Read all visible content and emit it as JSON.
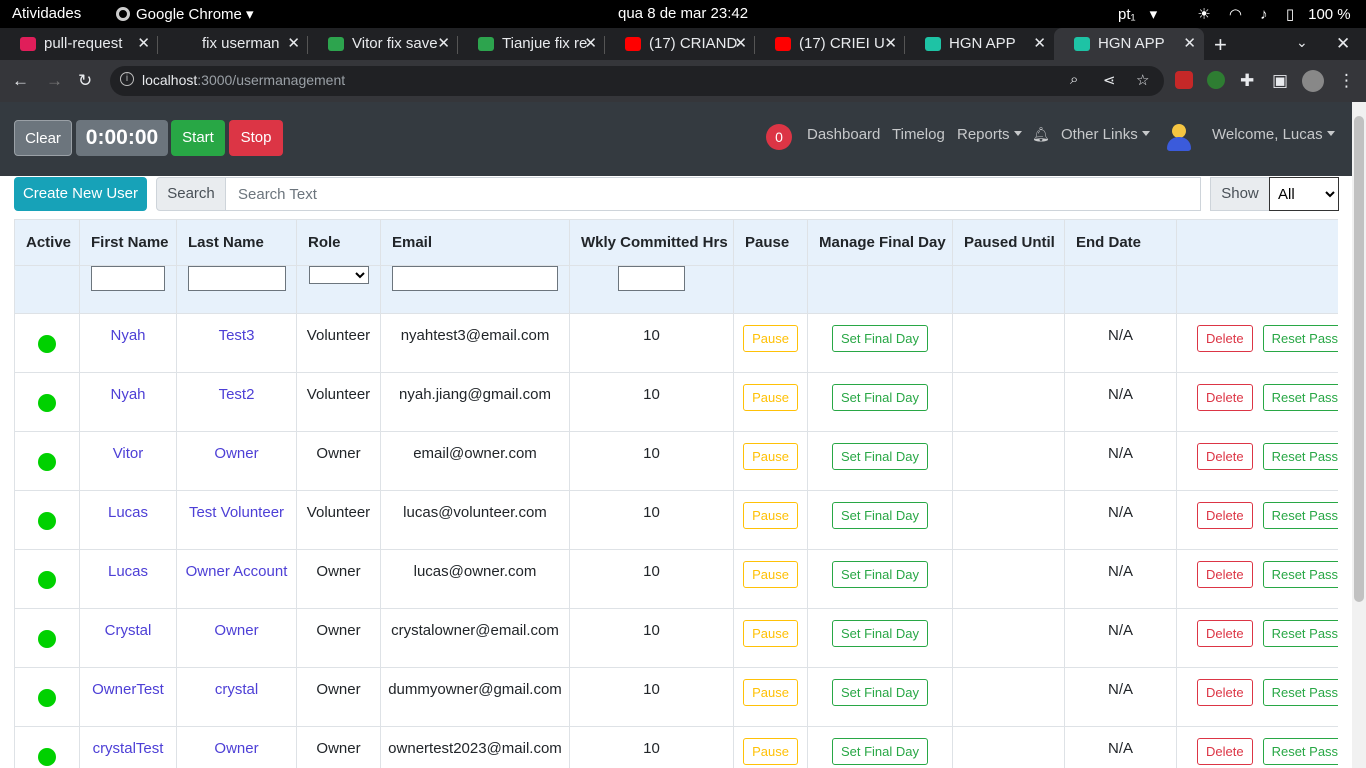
{
  "os": {
    "activities": "Atividades",
    "app": "Google Chrome",
    "clock": "qua 8 de mar  23:42",
    "lang": "pt₁",
    "battery": "100 %"
  },
  "tabs": [
    {
      "title": "pull-request",
      "favicon_color": "#e01e5a"
    },
    {
      "title": "fix userman",
      "favicon_color": "#202124"
    },
    {
      "title": "Vitor fix save",
      "favicon_color": "#2da44e"
    },
    {
      "title": "Tianjue fix re",
      "favicon_color": "#2da44e"
    },
    {
      "title": "(17) CRIAND",
      "favicon_color": "#ff0000"
    },
    {
      "title": "(17) CRIEI U",
      "favicon_color": "#ff0000"
    },
    {
      "title": "HGN APP",
      "favicon_color": "#1ec3a5"
    },
    {
      "title": "HGN APP",
      "favicon_color": "#1ec3a5"
    }
  ],
  "address": {
    "host": "localhost",
    "path": ":3000/usermanagement"
  },
  "header": {
    "clear": "Clear",
    "timer": "0:00:00",
    "start": "Start",
    "stop": "Stop",
    "notifications": "0",
    "dashboard": "Dashboard",
    "timelog": "Timelog",
    "reports": "Reports",
    "other_links": "Other Links",
    "welcome": "Welcome, Lucas"
  },
  "toolbar": {
    "create": "Create New User",
    "search_label": "Search",
    "search_placeholder": "Search Text",
    "show_label": "Show",
    "show_value": "All"
  },
  "columns": [
    "Active",
    "First Name",
    "Last Name",
    "Role",
    "Email",
    "Wkly Committed Hrs",
    "Pause",
    "Manage Final Day",
    "Paused Until",
    "End Date",
    ""
  ],
  "action_labels": {
    "pause": "Pause",
    "final": "Set Final Day",
    "delete": "Delete",
    "reset": "Reset Password"
  },
  "users": [
    {
      "first": "Nyah",
      "last": "Test3",
      "role": "Volunteer",
      "email": "nyahtest3@email.com",
      "hrs": "10",
      "paused_until": "",
      "end": "N/A"
    },
    {
      "first": "Nyah",
      "last": "Test2",
      "role": "Volunteer",
      "email": "nyah.jiang@gmail.com",
      "hrs": "10",
      "paused_until": "",
      "end": "N/A"
    },
    {
      "first": "Vitor",
      "last": "Owner",
      "role": "Owner",
      "email": "email@owner.com",
      "hrs": "10",
      "paused_until": "",
      "end": "N/A"
    },
    {
      "first": "Lucas",
      "last": "Test Volunteer",
      "role": "Volunteer",
      "email": "lucas@volunteer.com",
      "hrs": "10",
      "paused_until": "",
      "end": "N/A"
    },
    {
      "first": "Lucas",
      "last": "Owner Account",
      "role": "Owner",
      "email": "lucas@owner.com",
      "hrs": "10",
      "paused_until": "",
      "end": "N/A"
    },
    {
      "first": "Crystal",
      "last": "Owner",
      "role": "Owner",
      "email": "crystalowner@email.com",
      "hrs": "10",
      "paused_until": "",
      "end": "N/A"
    },
    {
      "first": "OwnerTest",
      "last": "crystal",
      "role": "Owner",
      "email": "dummyowner@gmail.com",
      "hrs": "10",
      "paused_until": "",
      "end": "N/A"
    },
    {
      "first": "crystalTest",
      "last": "Owner",
      "role": "Owner",
      "email": "ownertest2023@mail.com",
      "hrs": "10",
      "paused_until": "",
      "end": "N/A"
    }
  ]
}
